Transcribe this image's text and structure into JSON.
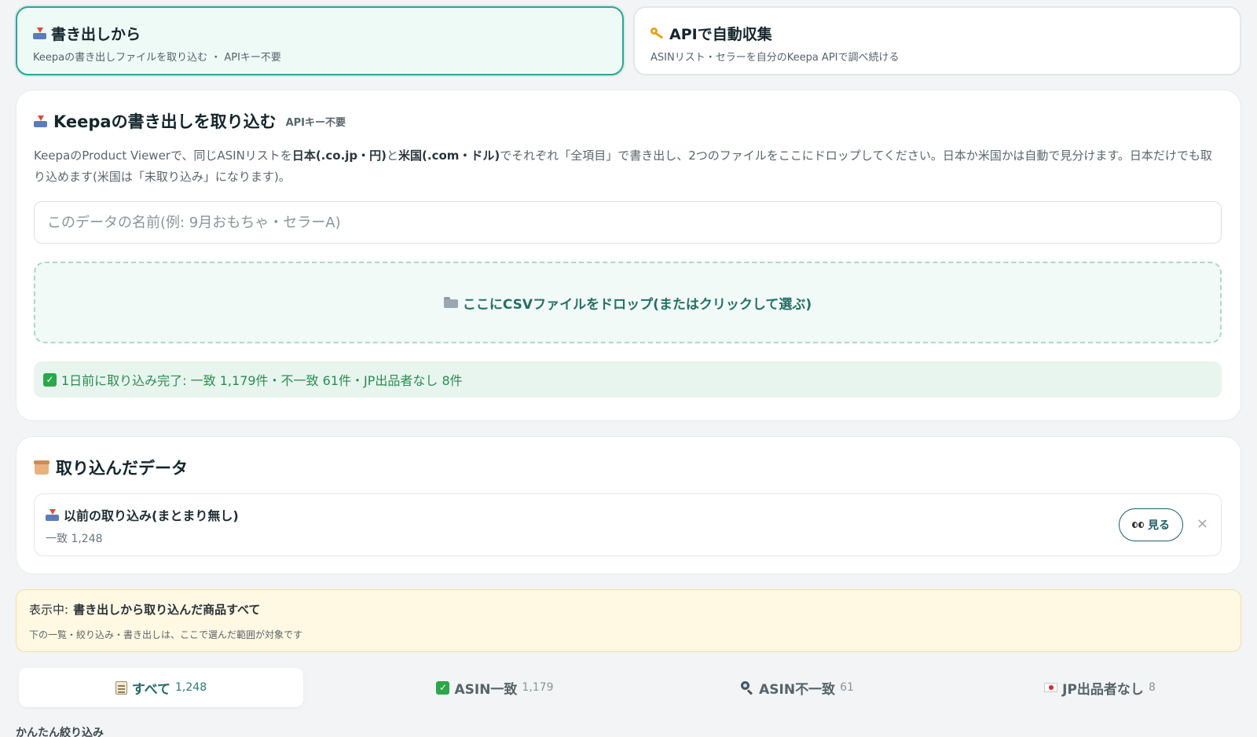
{
  "modes": {
    "export": {
      "title": "書き出しから",
      "subtitle": "Keepaの書き出しファイルを取り込む ・ APIキー不要"
    },
    "api": {
      "title": "APIで自動収集",
      "subtitle": "ASINリスト・セラーを自分のKeepa APIで調べ続ける"
    }
  },
  "import": {
    "title": "Keepaの書き出しを取り込む",
    "badge": "APIキー不要",
    "desc": {
      "p1": "KeepaのProduct Viewerで、同じASINリストを",
      "jp": "日本(.co.jp・円)",
      "p2": "と",
      "us": "米国(.com・ドル)",
      "p3": "でそれぞれ「全項目」で書き出し、2つのファイルをここにドロップしてください。日本か米国かは自動で見分けます。日本だけでも取り込めます(米国は「未取り込み」になります)。"
    },
    "name_placeholder": "このデータの名前(例: 9月おもちゃ・セラーA)",
    "dropzone_label": "ここにCSVファイルをドロップ(またはクリックして選ぶ)",
    "status": "1日前に取り込み完了: 一致 1,179件・不一致 61件・JP出品者なし 8件"
  },
  "imported": {
    "title": "取り込んだデータ",
    "item": {
      "title": "以前の取り込み(まとまり無し)",
      "sub": "一致 1,248",
      "view_label": "見る",
      "close_label": "×"
    }
  },
  "showing": {
    "prefix": "表示中:",
    "value": "書き出しから取り込んだ商品すべて",
    "note": "下の一覧・絞り込み・書き出しは、ここで選んだ範囲が対象です"
  },
  "tabs": [
    {
      "label": "すべて",
      "count": "1,248"
    },
    {
      "label": "ASIN一致",
      "count": "1,179"
    },
    {
      "label": "ASIN不一致",
      "count": "61"
    },
    {
      "label": "JP出品者なし",
      "count": "8"
    }
  ],
  "quick_filter_label": "かんたん絞り込み",
  "icons": {
    "export": "inbox-tray-icon",
    "api": "key-icon",
    "dropzone": "folder-icon",
    "imported": "card-file-box-icon",
    "view": "eyes-icon",
    "tab_all": "memo-icon",
    "tab_match": "check-mark-icon",
    "tab_mismatch": "magnifier-icon",
    "tab_nojp": "japan-flag-icon"
  },
  "colors": {
    "accent": "#2fa395",
    "success": "#2d8a52",
    "notice_bg": "#fff8e3"
  }
}
